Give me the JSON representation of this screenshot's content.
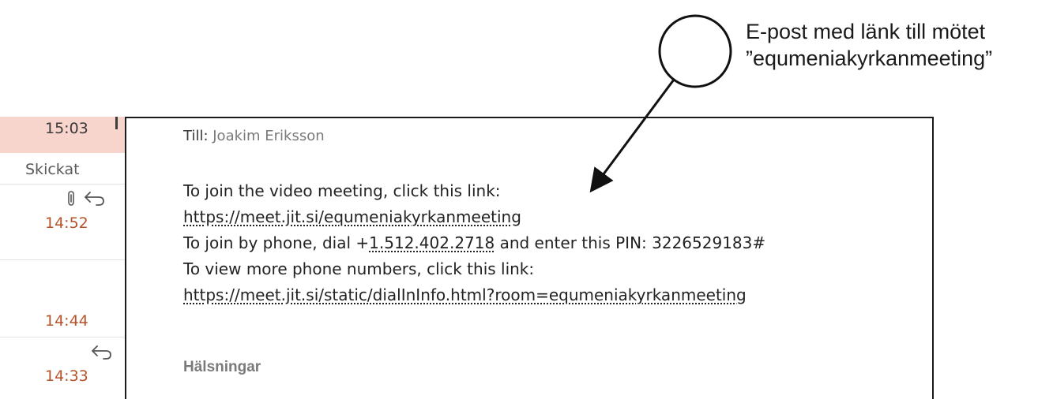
{
  "mail_list": {
    "selected_time": "15:03",
    "status_label": "Skickat",
    "items": [
      {
        "time": "14:52",
        "icons": [
          "paperclip-icon",
          "reply-icon"
        ]
      },
      {
        "time": "14:44",
        "icons": []
      },
      {
        "time": "14:33",
        "icons": [
          "reply-icon"
        ]
      }
    ]
  },
  "reading_pane": {
    "to_label": "Till:",
    "to_value": "Joakim Eriksson",
    "video_intro": "To join the video meeting, click this link:",
    "meeting_link": "https://meet.jit.si/equmeniakyrkanmeeting",
    "phone_prefix": "To join by phone, dial +",
    "phone_number": "1.512.402.2718",
    "phone_suffix": " and enter this PIN: 3226529183#",
    "more_numbers_intro": "To view more phone numbers, click this link:",
    "dial_in_link": "https://meet.jit.si/static/dialInInfo.html?room=equmeniakyrkanmeeting",
    "greeting": "Hälsningar"
  },
  "annotation": {
    "line1": "E-post med länk till mötet",
    "line2": "”equmeniakyrkanmeeting”"
  },
  "colors": {
    "time_accent": "#b4532a",
    "selected_row_bg": "#f7d4cc",
    "muted_text": "#7a7a7a"
  }
}
